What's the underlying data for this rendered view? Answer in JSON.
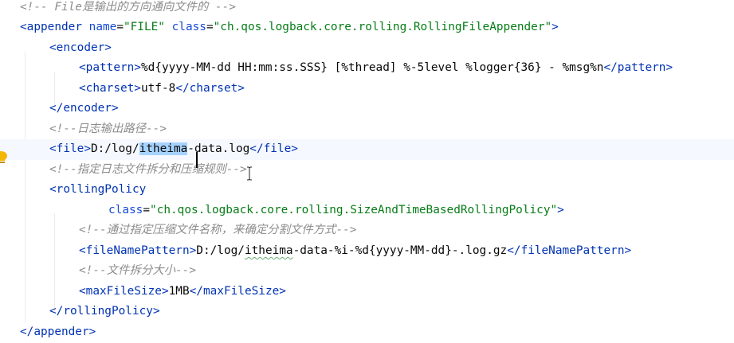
{
  "editor": {
    "lines": [
      [
        {
          "t": "<!-- File是输出的方向通向文件的 -->",
          "c": "cmt"
        }
      ],
      [
        {
          "t": "<",
          "c": "tag"
        },
        {
          "t": "appender",
          "c": "tag"
        },
        {
          "t": " ",
          "c": "txt"
        },
        {
          "t": "name",
          "c": "attr"
        },
        {
          "t": "=",
          "c": "txt"
        },
        {
          "t": "\"FILE\"",
          "c": "str"
        },
        {
          "t": " ",
          "c": "txt"
        },
        {
          "t": "class",
          "c": "attr"
        },
        {
          "t": "=",
          "c": "txt"
        },
        {
          "t": "\"ch.qos.logback.core.rolling.RollingFileAppender\"",
          "c": "str"
        },
        {
          "t": ">",
          "c": "tag"
        }
      ],
      [
        {
          "t": "<encoder>",
          "c": "tag"
        }
      ],
      [
        {
          "t": "<pattern>",
          "c": "tag"
        },
        {
          "t": "%d{yyyy-MM-dd HH:mm:ss.SSS} [%thread] %-5level %logger{36} - %msg%n",
          "c": "txt"
        },
        {
          "t": "</pattern>",
          "c": "tag"
        }
      ],
      [
        {
          "t": "<charset>",
          "c": "tag"
        },
        {
          "t": "utf-8",
          "c": "txt"
        },
        {
          "t": "</charset>",
          "c": "tag"
        }
      ],
      [
        {
          "t": "</encoder>",
          "c": "tag"
        }
      ],
      [
        {
          "t": "<!--日志输出路径-->",
          "c": "cmt"
        }
      ],
      [
        {
          "t": "<file>",
          "c": "tag"
        },
        {
          "t": "D:/log/",
          "c": "txt"
        },
        {
          "t": "itheima",
          "c": "txt sel"
        },
        {
          "t": "-data.log",
          "c": "txt"
        },
        {
          "t": "</file>",
          "c": "tag"
        }
      ],
      [
        {
          "t": "<!--指定日志文件拆分和压缩规则-->",
          "c": "cmt"
        }
      ],
      [
        {
          "t": "<rollingPolicy",
          "c": "tag"
        }
      ],
      [
        {
          "t": "class",
          "c": "attr"
        },
        {
          "t": "=",
          "c": "txt"
        },
        {
          "t": "\"ch.qos.logback.core.rolling.SizeAndTimeBasedRollingPolicy\"",
          "c": "str"
        },
        {
          "t": ">",
          "c": "tag"
        }
      ],
      [
        {
          "t": "<!--通过指定压缩文件名称，来确定分割文件方式-->",
          "c": "cmt"
        }
      ],
      [
        {
          "t": "<fileNamePattern>",
          "c": "tag"
        },
        {
          "t": "D:/log/",
          "c": "txt"
        },
        {
          "t": "itheima",
          "c": "txt typo"
        },
        {
          "t": "-data-%i-%d{yyyy-MM-dd}-.log.gz",
          "c": "txt"
        },
        {
          "t": "</fileNamePattern>",
          "c": "tag"
        }
      ],
      [
        {
          "t": "<!--文件拆分大小-->",
          "c": "cmt"
        }
      ],
      [
        {
          "t": "<maxFileSize>",
          "c": "tag"
        },
        {
          "t": "1MB",
          "c": "txt"
        },
        {
          "t": "</maxFileSize>",
          "c": "tag"
        }
      ],
      [
        {
          "t": "</rollingPolicy>",
          "c": "tag"
        }
      ],
      [
        {
          "t": "</appender>",
          "c": "tag"
        }
      ]
    ],
    "current_line": 7
  },
  "icons": {
    "gutter": "intention-bulb-icon",
    "cursor": "text-cursor-icon"
  },
  "colors": {
    "tag": "#0033b3",
    "attribute": "#174ad4",
    "string": "#067d17",
    "comment": "#8c8c8c",
    "text": "#080808",
    "selection": "#a6d2ff",
    "current_line": "#f5f8fe"
  }
}
